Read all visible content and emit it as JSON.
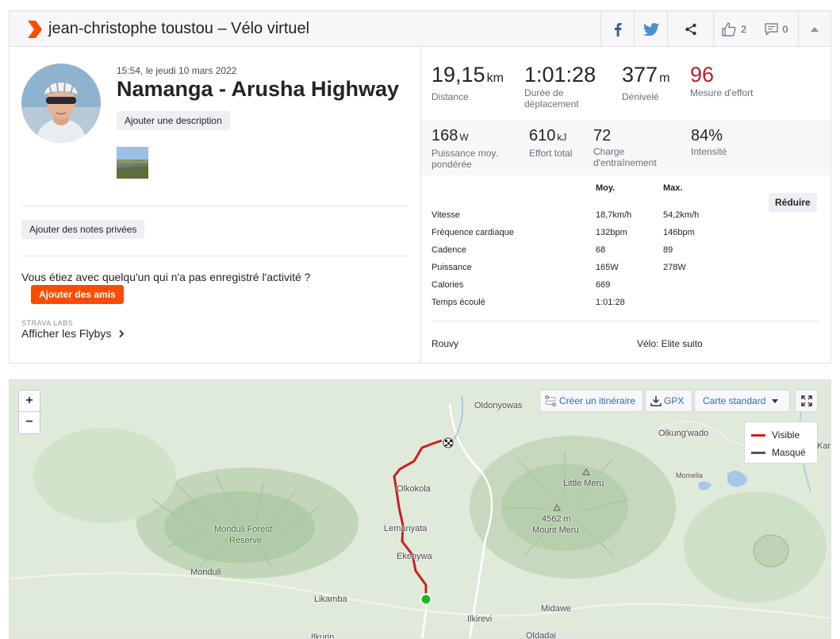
{
  "header": {
    "title": "jean-christophe toustou – Vélo virtuel",
    "kudos_count": "2",
    "comments_count": "0",
    "icons": [
      "strava-ride-icon",
      "facebook-icon",
      "twitter-icon",
      "share-icon",
      "thumbs-up-icon",
      "comment-icon",
      "chevron-up-icon"
    ],
    "accent_color": "#fc4c02"
  },
  "activity": {
    "date": "15:54, le jeudi 10 mars 2022",
    "name": "Namanga - Arusha Highway",
    "add_description": "Ajouter une description",
    "add_private_notes": "Ajouter des notes privées",
    "with_someone": "Vous étiez avec quelqu'un qui n'a pas enregistré l'activité ?",
    "add_friends": "Ajouter des amis",
    "labs_label": "STRAVA LABS",
    "flyby_label": "Afficher les Flybys"
  },
  "stats_primary": [
    {
      "value": "19,15",
      "unit": "km",
      "label": "Distance"
    },
    {
      "value": "1:01:28",
      "unit": "",
      "label": "Durée de déplacement"
    },
    {
      "value": "377",
      "unit": "m",
      "label": "Dénivelé"
    },
    {
      "value": "96",
      "unit": "",
      "label": "Mesure d'effort",
      "color": "#bf1d2b"
    }
  ],
  "stats_secondary": [
    {
      "value": "168",
      "unit": "W",
      "label": "Puissance moy. pondérée"
    },
    {
      "value": "610",
      "unit": "kJ",
      "label": "Effort total"
    },
    {
      "value": "72",
      "unit": "",
      "label": "Charge d'entraînement"
    },
    {
      "value": "84%",
      "unit": "",
      "label": "Intensité"
    }
  ],
  "details": {
    "col_avg": "Moy.",
    "col_max": "Max.",
    "reduce_label": "Réduire",
    "rows": [
      {
        "label": "Vitesse",
        "avg": "18,7km/h",
        "max": "54,2km/h"
      },
      {
        "label": "Fréquence cardiaque",
        "avg": "132bpm",
        "max": "146bpm"
      },
      {
        "label": "Cadence",
        "avg": "68",
        "max": "89"
      },
      {
        "label": "Puissance",
        "avg": "165W",
        "max": "278W"
      },
      {
        "label": "Calories",
        "avg": "669",
        "max": ""
      },
      {
        "label": "Temps écoulé",
        "avg": "1:01:28",
        "max": ""
      }
    ],
    "device": "Rouvy",
    "bike": "Vélo: Elite suito"
  },
  "map": {
    "zoom_in": "+",
    "zoom_out": "−",
    "create_route": "Créer un itinéraire",
    "gpx": "GPX",
    "map_type": "Carte standard",
    "legend_visible": "Visible",
    "legend_hidden": "Masqué",
    "route_color": "#cc1f1f",
    "hidden_color": "#555555",
    "places": {
      "oldonyowas": "Oldonyowas",
      "olkungwado": "Olkung'wado",
      "kara": "Kara",
      "momella": "Momella",
      "little_meru": "Little Meru",
      "olkokola": "Olkokola",
      "meru_elev": "4562 m",
      "mount_meru": "Mount Meru",
      "monduli_forest": "Monduli Forest",
      "reserve": "Reserve",
      "lemanyata": "Lemanyata",
      "ekenywa": "Ekenywa",
      "monduli": "Monduli",
      "likamba": "Likamba",
      "midawe": "Midawe",
      "ilkirevi": "Ilkirevi",
      "ilkurin": "Ilkurin",
      "oldadai": "Oldadai"
    }
  }
}
